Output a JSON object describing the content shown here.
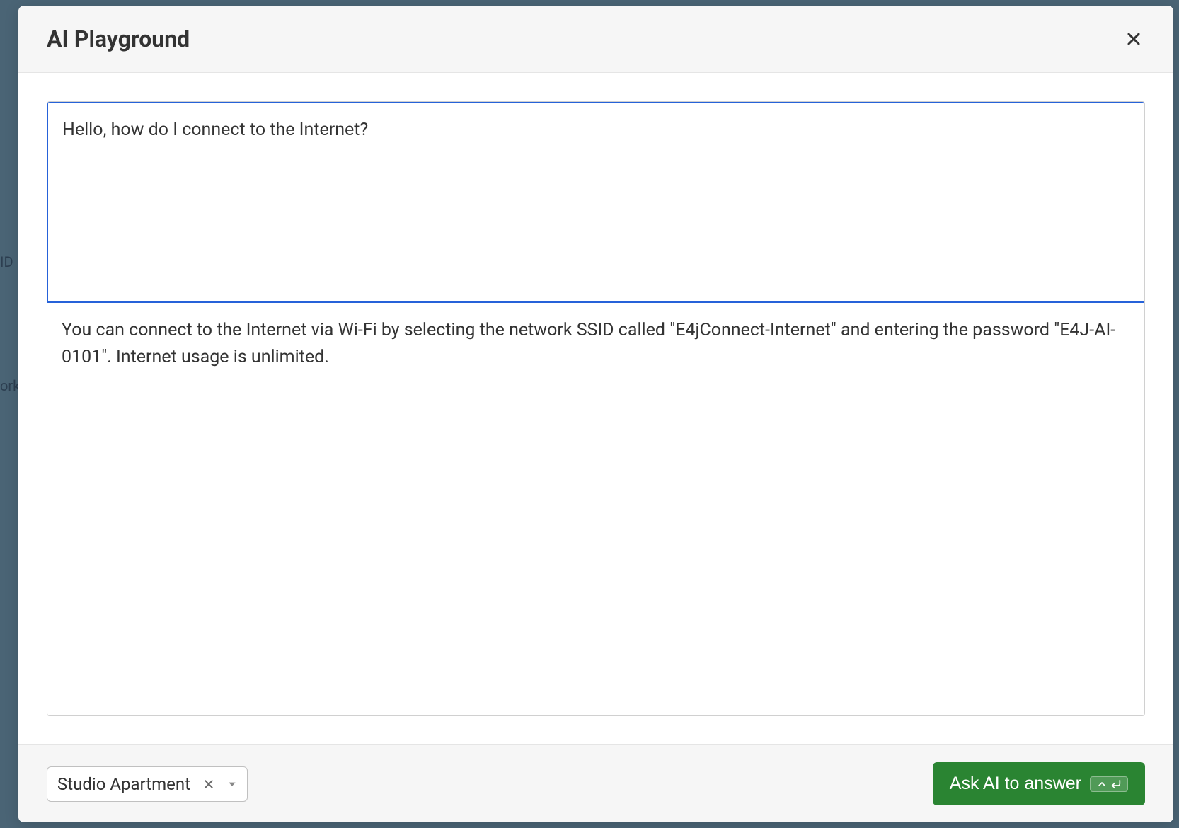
{
  "background": {
    "text1": "ID",
    "text2": "ork"
  },
  "modal": {
    "title": "AI Playground",
    "input_value": "Hello, how do I connect to the Internet?",
    "output_text": "You can connect to the Internet via Wi-Fi by selecting the network SSID called \"E4jConnect-Internet\" and entering the password \"E4J-AI-0101\". Internet usage is unlimited."
  },
  "footer": {
    "selected_option": "Studio Apartment",
    "ask_button_label": "Ask AI to answer"
  }
}
